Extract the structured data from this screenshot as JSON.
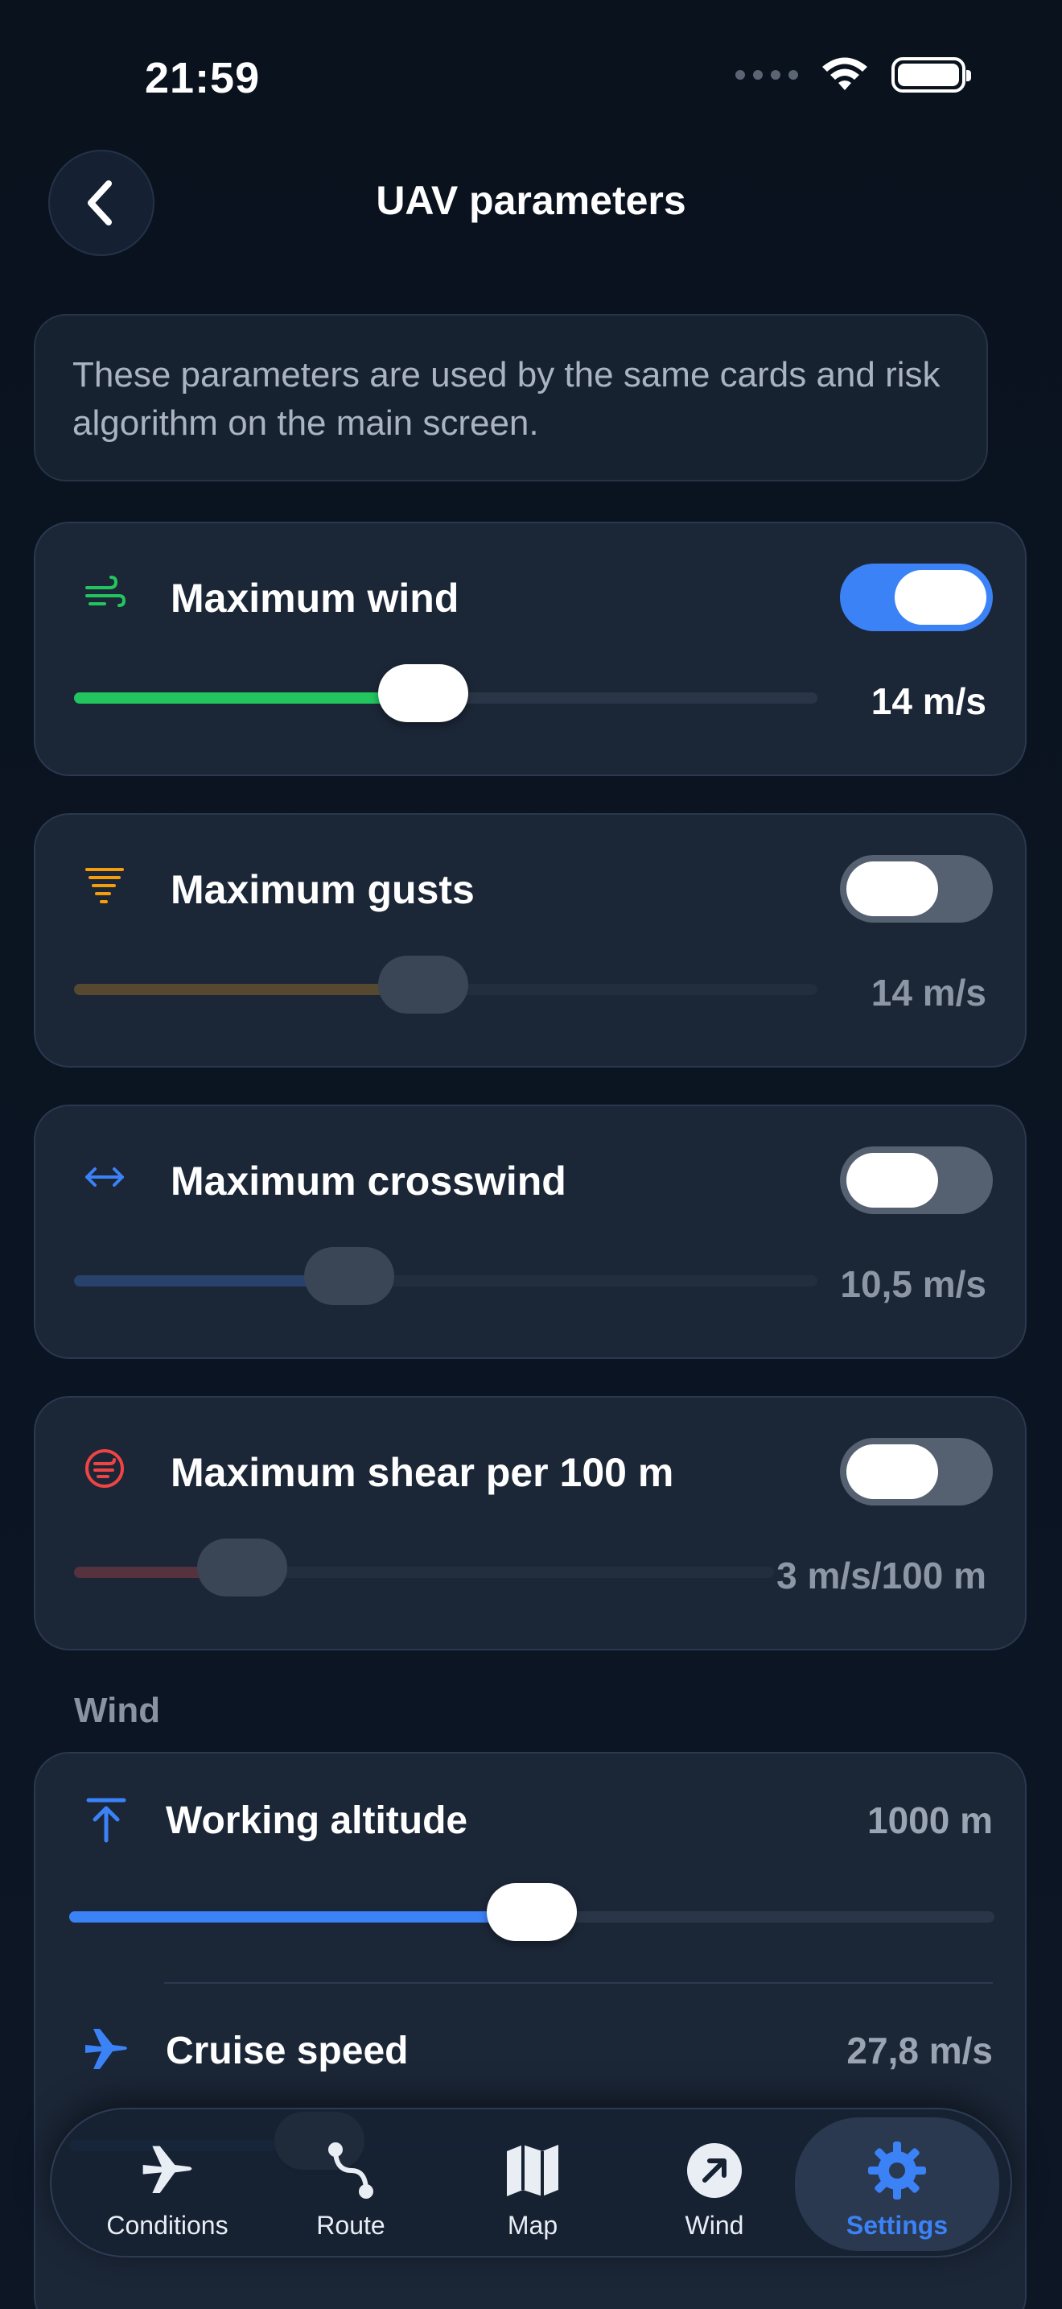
{
  "status": {
    "time": "21:59"
  },
  "header": {
    "title": "UAV parameters"
  },
  "info": {
    "text": "These parameters are used by the same cards and risk algorithm on the main screen."
  },
  "cards": [
    {
      "title": "Maximum wind",
      "value": "14 m/s",
      "enabled": true,
      "fraction": 0.47,
      "color": "#22c55e"
    },
    {
      "title": "Maximum gusts",
      "value": "14 m/s",
      "enabled": false,
      "fraction": 0.47,
      "color": "#f59e0b"
    },
    {
      "title": "Maximum crosswind",
      "value": "10,5 m/s",
      "enabled": false,
      "fraction": 0.37,
      "color": "#3b82f6"
    },
    {
      "title": "Maximum shear per 100 m",
      "value": "3 m/s/100 m",
      "enabled": false,
      "fraction": 0.24,
      "color": "#ef4444"
    }
  ],
  "wind_section": {
    "label": "Wind",
    "rows": [
      {
        "title": "Working altitude",
        "value": "1000 m",
        "fraction": 0.5,
        "color": "#3b82f6"
      },
      {
        "title": "Cruise speed",
        "value": "27,8 m/s",
        "fraction": 0.27,
        "color": "#3b82f6"
      }
    ]
  },
  "tabbar": {
    "tabs": [
      {
        "label": "Conditions",
        "icon": "airplane-icon",
        "active": false
      },
      {
        "label": "Route",
        "icon": "route-icon",
        "active": false
      },
      {
        "label": "Map",
        "icon": "map-icon",
        "active": false
      },
      {
        "label": "Wind",
        "icon": "wind-arrow-icon",
        "active": false
      },
      {
        "label": "Settings",
        "icon": "gear-icon",
        "active": true
      }
    ]
  },
  "colors": {
    "accent": "#3b82f6",
    "background": "#0a121e",
    "card": "#1b2637"
  }
}
